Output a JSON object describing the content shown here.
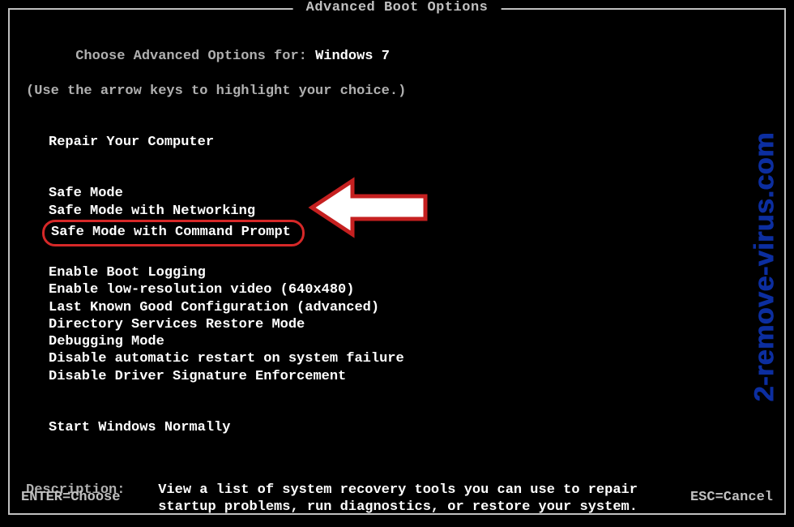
{
  "title": "Advanced Boot Options",
  "header_prefix": "Choose Advanced Options for: ",
  "os_name": "Windows 7",
  "hint": "(Use the arrow keys to highlight your choice.)",
  "sections": {
    "repair": "Repair Your Computer",
    "options_a": [
      "Safe Mode",
      "Safe Mode with Networking",
      "Safe Mode with Command Prompt"
    ],
    "options_b": [
      "Enable Boot Logging",
      "Enable low-resolution video (640x480)",
      "Last Known Good Configuration (advanced)",
      "Directory Services Restore Mode",
      "Debugging Mode",
      "Disable automatic restart on system failure",
      "Disable Driver Signature Enforcement"
    ],
    "options_c": [
      "Start Windows Normally"
    ]
  },
  "highlighted_option": "Safe Mode with Command Prompt",
  "description": {
    "label": "Description:",
    "body_line1": "View a list of system recovery tools you can use to repair",
    "body_line2": "startup problems, run diagnostics, or restore your system."
  },
  "footer": {
    "enter": "ENTER=Choose",
    "esc": "ESC=Cancel"
  },
  "watermark": "2-remove-virus.com",
  "arrow_colors": {
    "stroke": "#c52020",
    "fill": "#ffffff"
  }
}
